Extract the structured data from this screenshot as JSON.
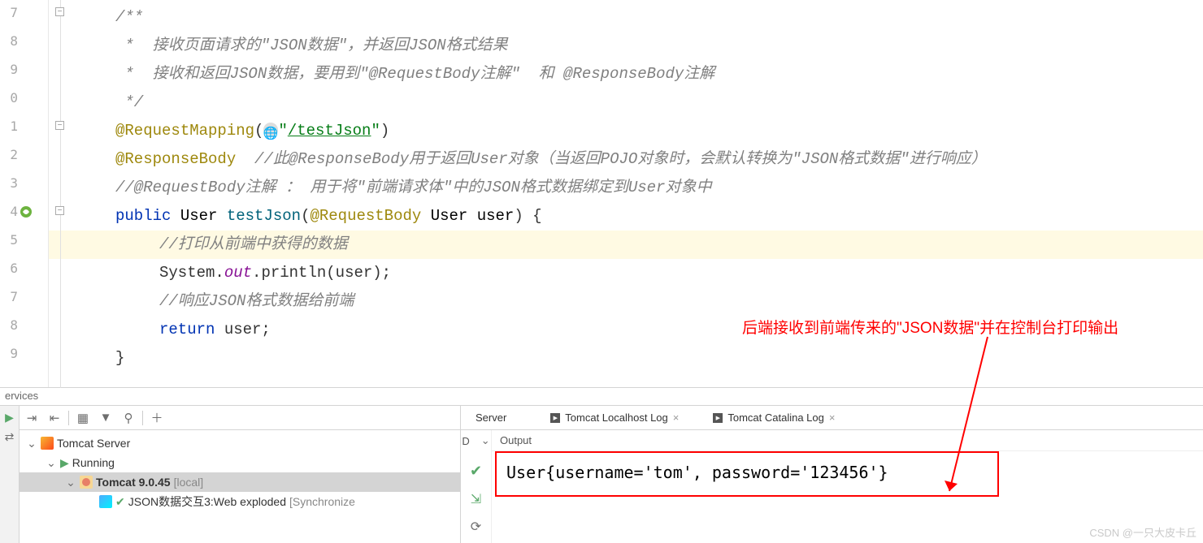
{
  "gutter_lines": [
    "7",
    "8",
    "9",
    "0",
    "1",
    "2",
    "3",
    "4",
    "5",
    "6",
    "7",
    "8",
    "9"
  ],
  "code": {
    "c1_open": "/**",
    "c2": " *  接收页面请求的\"JSON数据\"，并返回JSON格式结果",
    "c3": " *  接收和返回JSON数据，要用到\"@RequestBody注解\"  和 @ResponseBody注解",
    "c4": " */",
    "mapping_ann": "@RequestMapping",
    "mapping_open": "(",
    "mapping_url": "\"/testJson\"",
    "mapping_url_inner": "/testJson",
    "mapping_close": ")",
    "resp_ann": "@ResponseBody",
    "resp_cmt": "  //此@ResponseBody用于返回User对象（当返回POJO对象时，会默认转换为\"JSON格式数据\"进行响应）",
    "reqbody_cmt": "//@RequestBody注解 ： 用于将\"前端请求体\"中的JSON格式数据绑定到User对象中",
    "kw_public": "public",
    "type_user": "User",
    "method_name": "testJson",
    "param_ann": "@RequestBody",
    "param_type": "User",
    "param_name": "user",
    "brace_open": " {",
    "print_cmt": "//打印从前端中获得的数据",
    "sysout_a": "System.",
    "sysout_b": "out",
    "sysout_c": ".println(user);",
    "resp_json_cmt": "//响应JSON格式数据给前端",
    "kw_return": "return",
    "ret_expr": " user;",
    "brace_close": "}"
  },
  "annotation_text": "后端接收到前端传来的\"JSON数据\"并在控制台打印输出",
  "services_label": "ervices",
  "tree": {
    "root": "Tomcat Server",
    "running": "Running",
    "server": "Tomcat 9.0.45",
    "server_suffix": "[local]",
    "deploy": "JSON数据交互3:Web exploded",
    "deploy_suffix": "[Synchronize"
  },
  "tabs": {
    "server": "Server",
    "log1": "Tomcat Localhost Log",
    "log2": "Tomcat Catalina Log"
  },
  "out_sub_d": "D",
  "output_label": "Output",
  "output_text": "User{username='tom', password='123456'}",
  "watermark": "CSDN @一只大皮卡丘"
}
